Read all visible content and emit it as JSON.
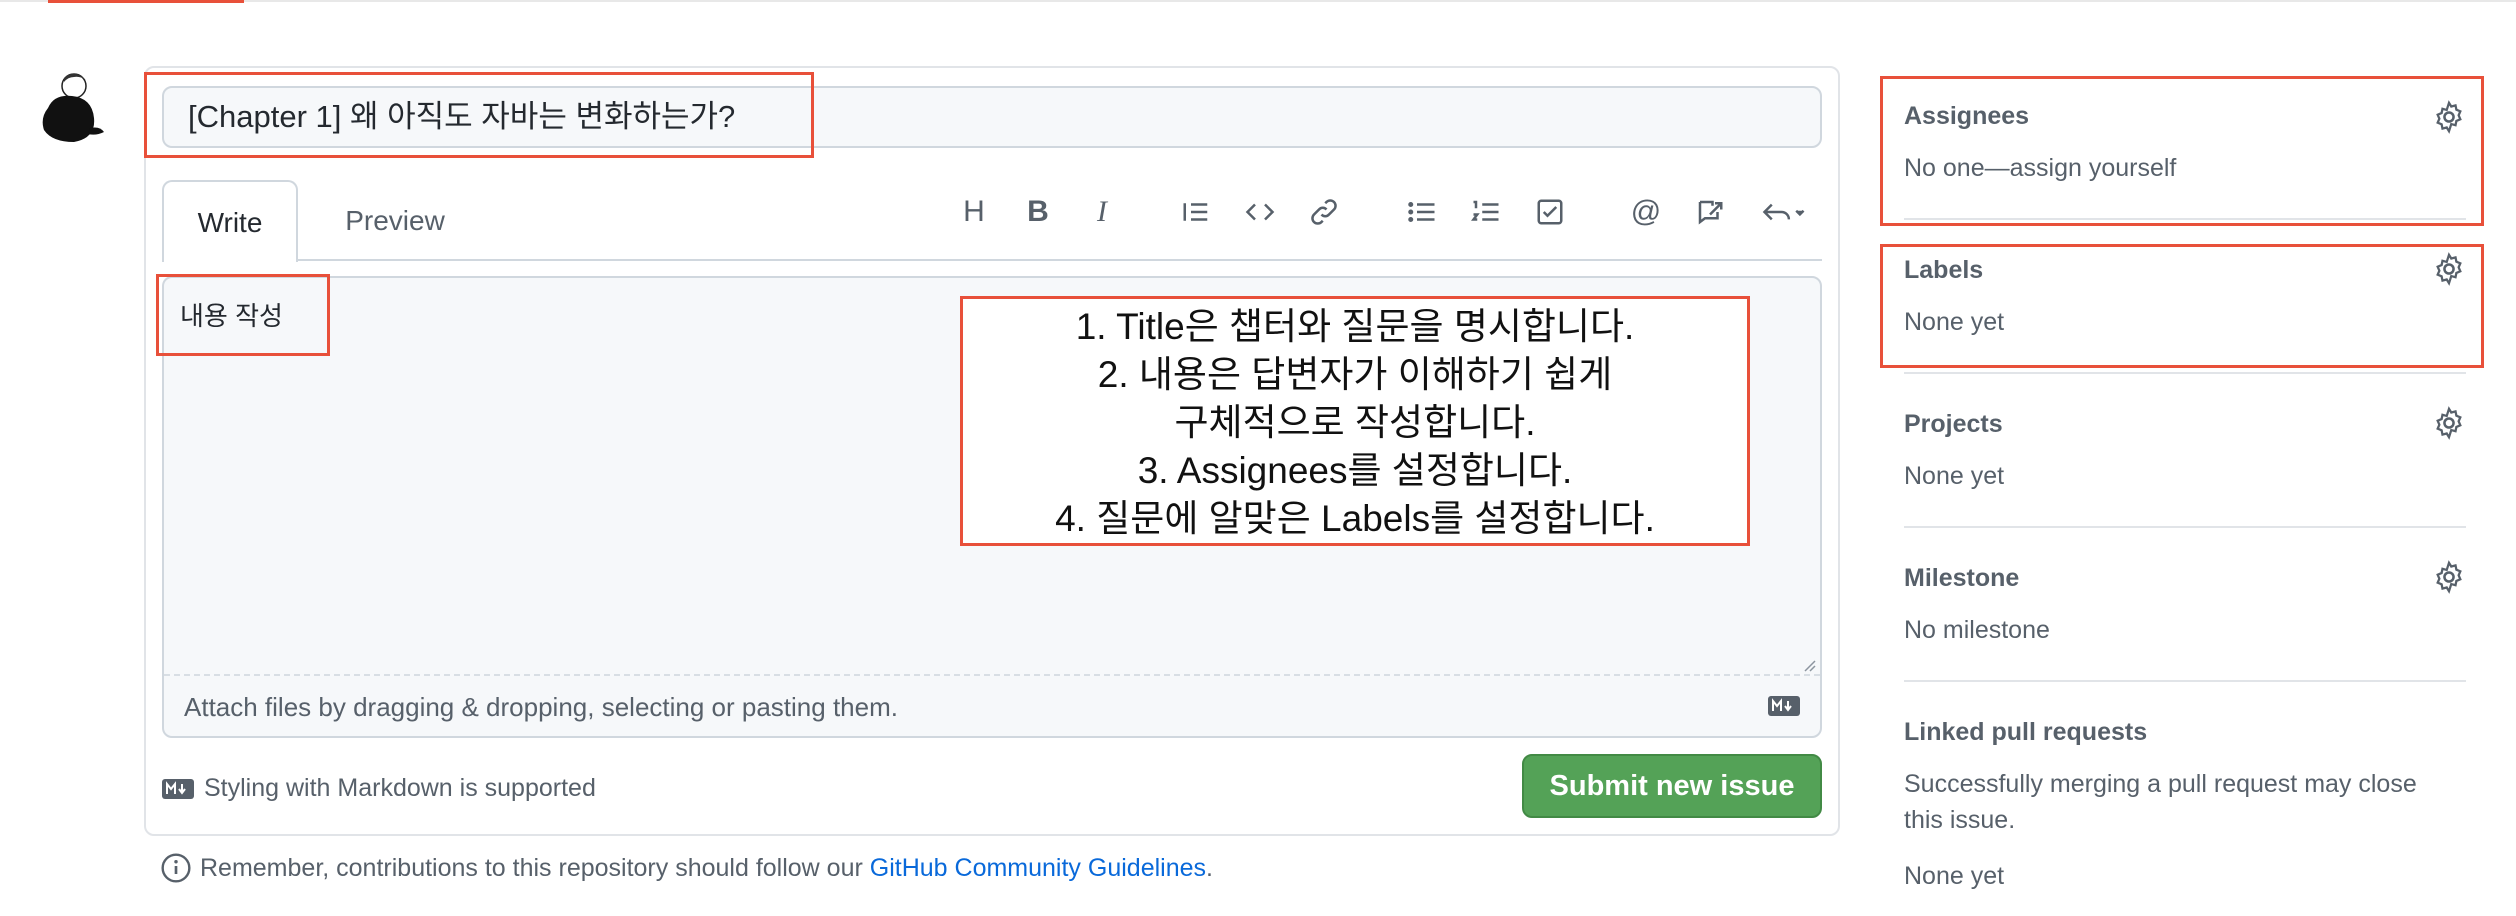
{
  "issue": {
    "title_value": "[Chapter 1] 왜 아직도 자바는 변화하는가?"
  },
  "tabs": {
    "write": "Write",
    "preview": "Preview"
  },
  "toolbar": {
    "icons": [
      "heading-icon",
      "bold-icon",
      "italic-icon",
      "quote-icon",
      "code-icon",
      "link-icon",
      "bulleted-list-icon",
      "numbered-list-icon",
      "task-list-icon",
      "mention-icon",
      "reference-icon",
      "reply-icon"
    ],
    "heading_glyph": "H",
    "bold_glyph": "B",
    "italic_glyph": "I",
    "mention_glyph": "@"
  },
  "editor": {
    "content": "내용 작성",
    "attach_hint": "Attach files by dragging & dropping, selecting or pasting them."
  },
  "footer": {
    "markdown_note": "Styling with Markdown is supported",
    "submit_label": "Submit new issue",
    "remember_prefix": "Remember, contributions to this repository should follow our ",
    "guidelines_link": "GitHub Community Guidelines",
    "remember_suffix": "."
  },
  "sidebar": {
    "assignees": {
      "heading": "Assignees",
      "value": "No one—assign yourself"
    },
    "labels": {
      "heading": "Labels",
      "value": "None yet"
    },
    "projects": {
      "heading": "Projects",
      "value": "None yet"
    },
    "milestone": {
      "heading": "Milestone",
      "value": "No milestone"
    },
    "linked_prs": {
      "heading": "Linked pull requests",
      "description_line1": "Successfully merging a pull request may close",
      "description_line2": "this issue.",
      "value": "None yet"
    }
  },
  "annotation_note": {
    "line1": "1. Title은 챕터와 질문을 명시합니다.",
    "line2": "2. 내용은 답변자가 이해하기 쉽게",
    "line3": "구체적으로 작성합니다.",
    "line4": "3. Assignees를 설정합니다.",
    "line5": "4. 질문에 알맞은 Labels를 설정합니다."
  },
  "colors": {
    "annotation_red": "#e8503a",
    "submit_green": "#54a257",
    "link_blue": "#0969da"
  }
}
